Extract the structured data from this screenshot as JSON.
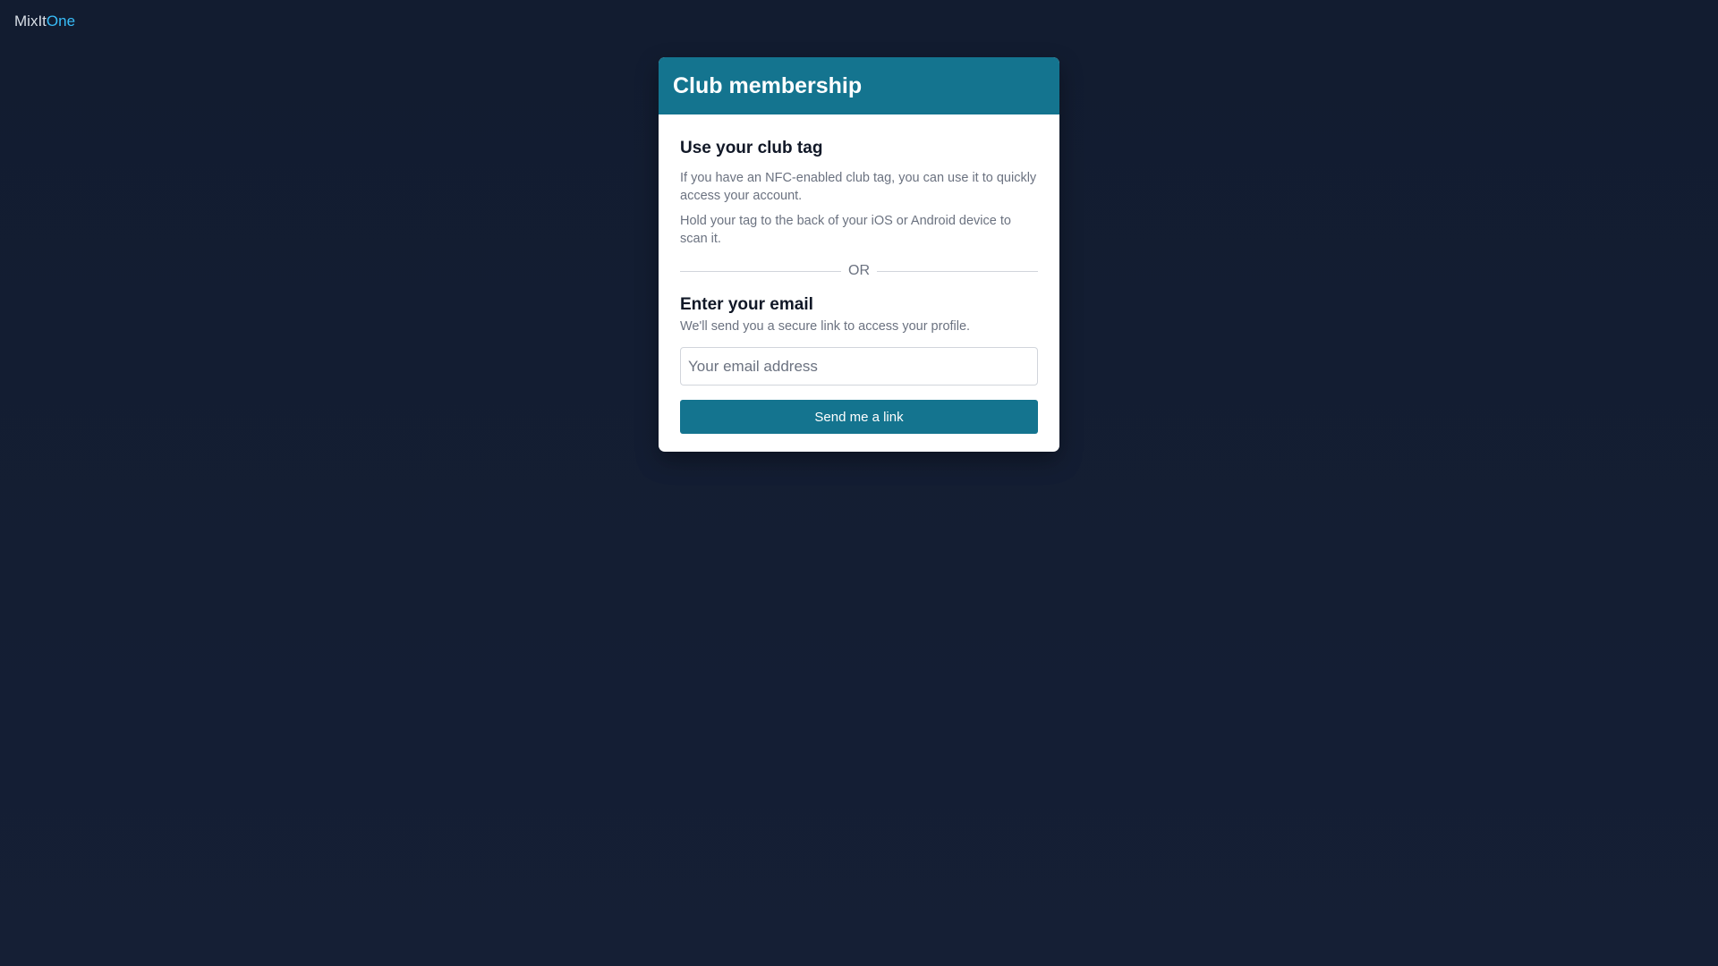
{
  "brand": {
    "part1": "MixIt",
    "part2": "One",
    "accent_color": "#38bdf8"
  },
  "card": {
    "title": "Club membership",
    "header_color": "#14748f",
    "tag_section": {
      "heading": "Use your club tag",
      "paragraph1": "If you have an NFC-enabled club tag, you can use it to quickly access your account.",
      "paragraph2": "Hold your tag to the back of your iOS or Android device to scan it."
    },
    "divider_text": "OR",
    "email_section": {
      "heading": "Enter your email",
      "subtext": "We'll send you a secure link to access your profile.",
      "input_value": "",
      "input_placeholder": "Your email address",
      "button_label": "Send me a link"
    }
  }
}
